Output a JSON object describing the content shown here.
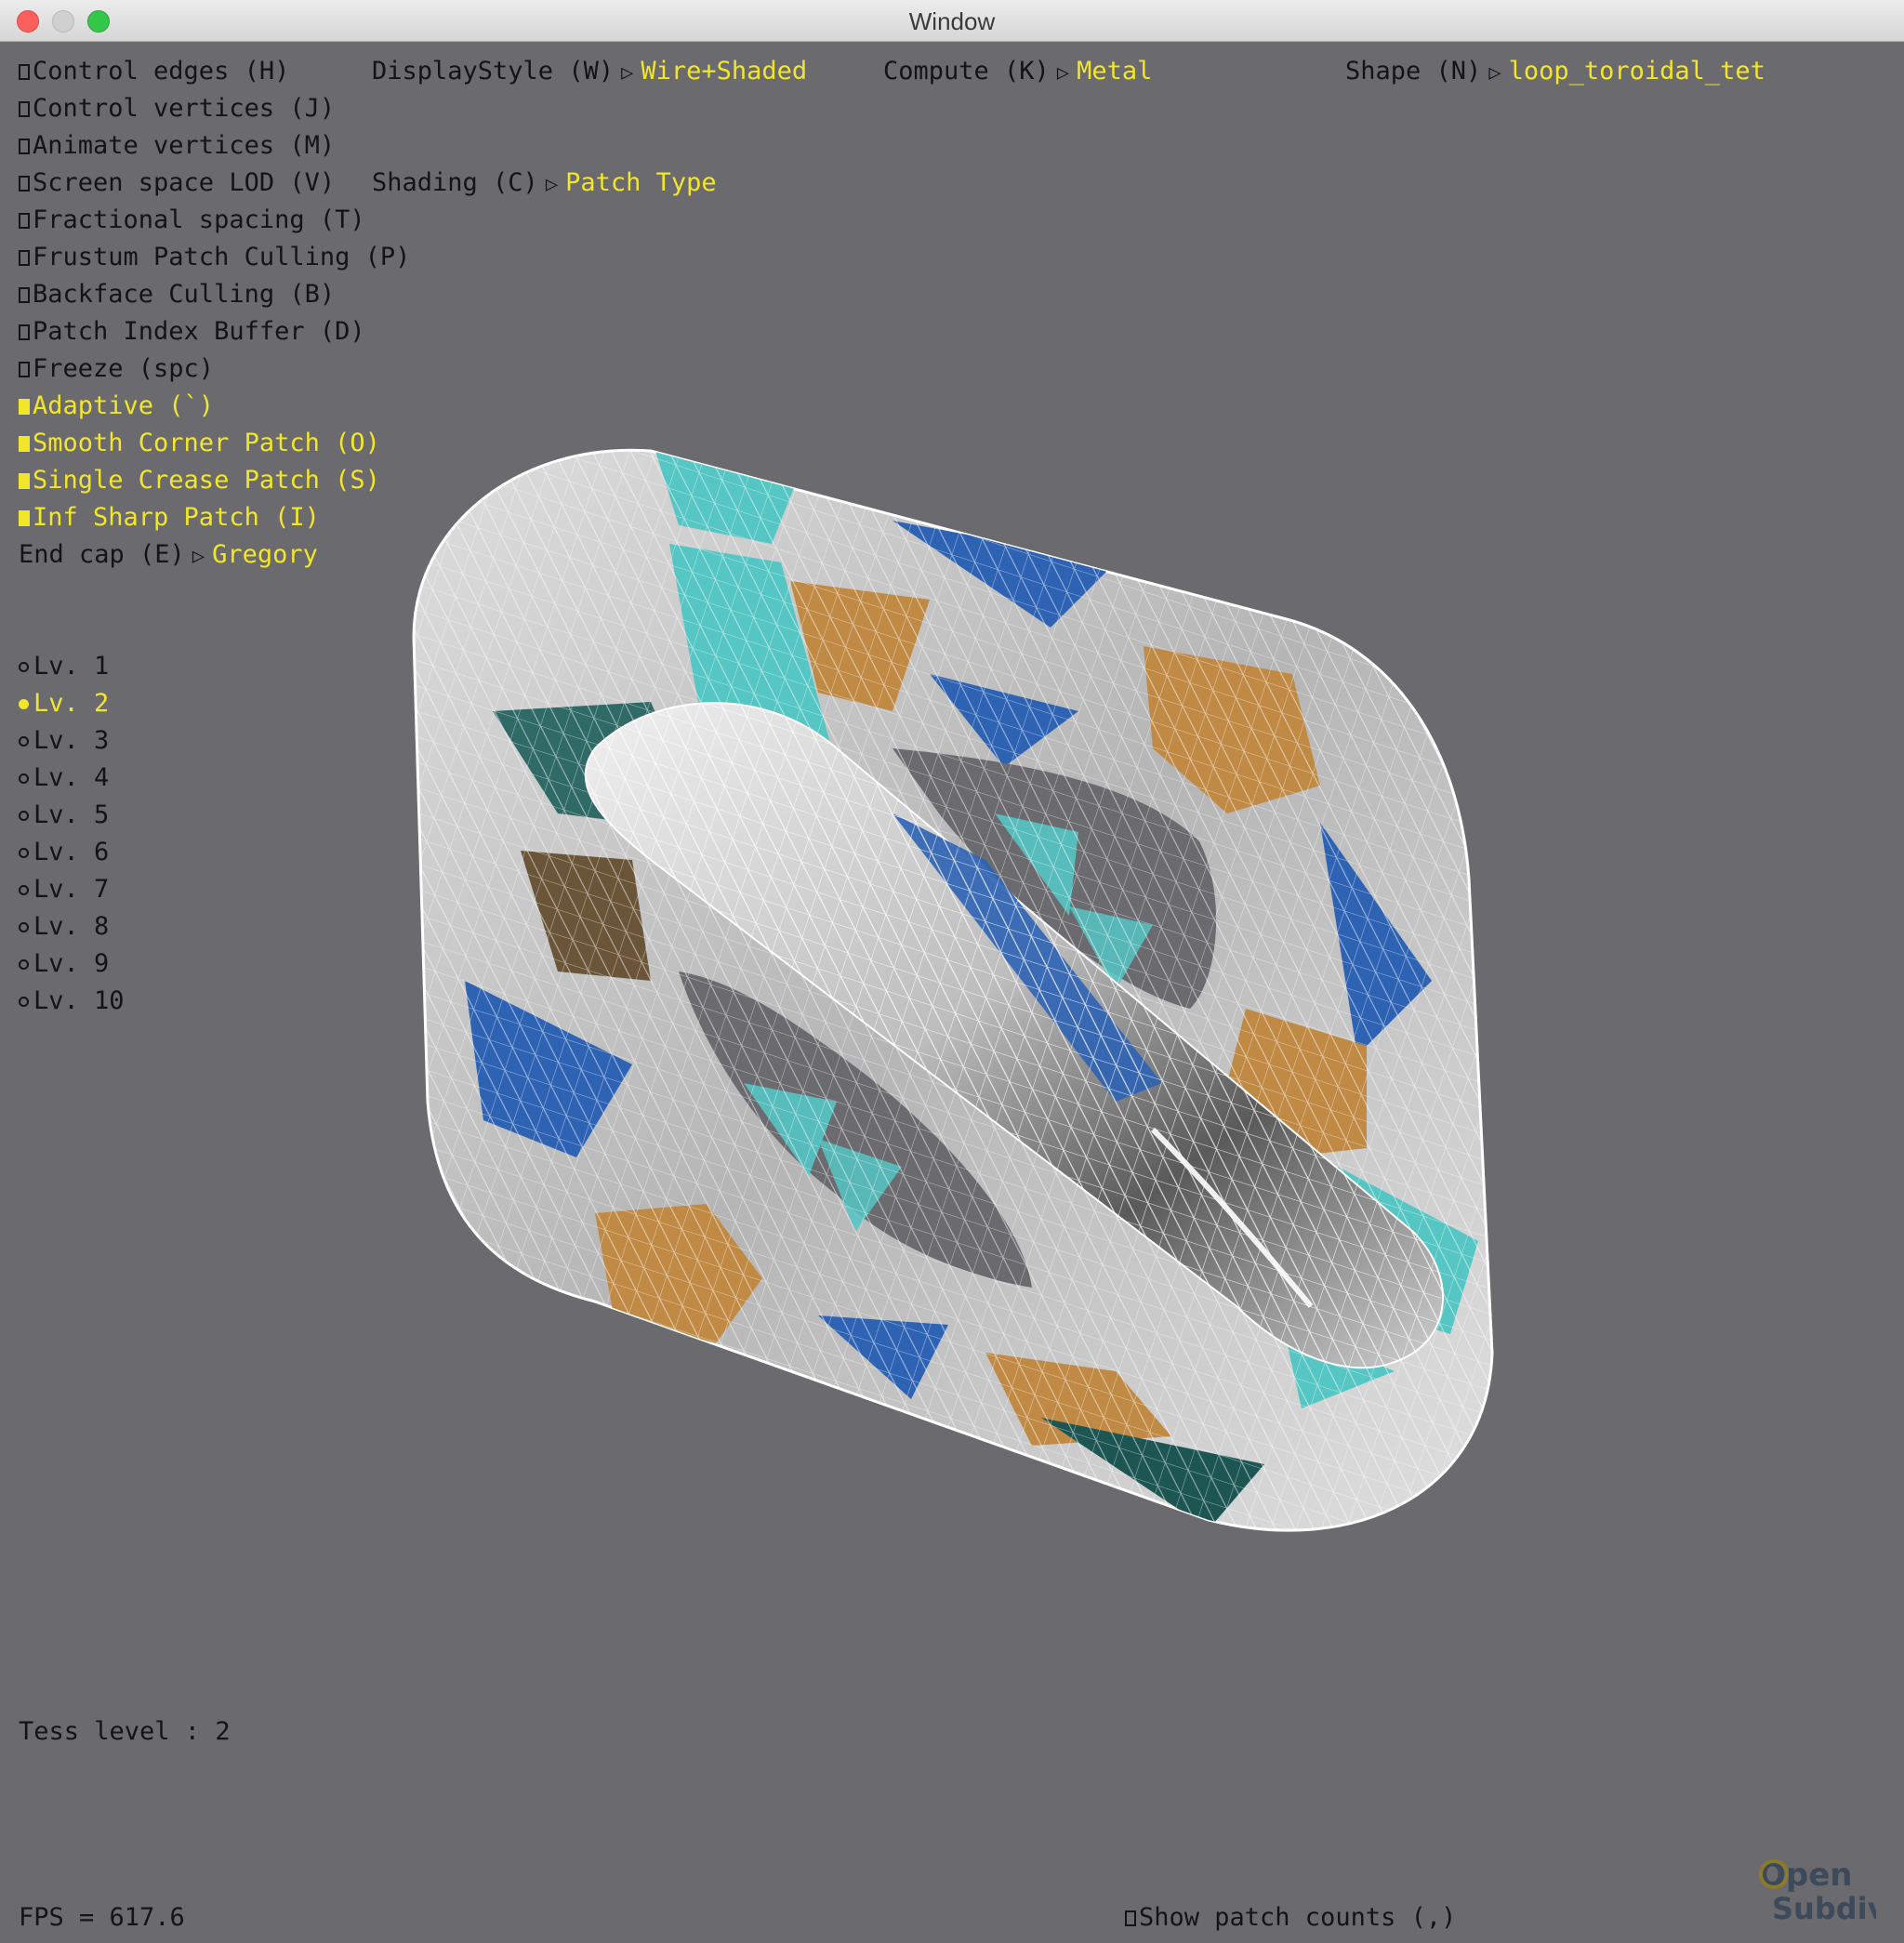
{
  "window": {
    "title": "Window"
  },
  "toggles": [
    {
      "label": "Control edges (H)",
      "checked": false
    },
    {
      "label": "Control vertices (J)",
      "checked": false
    },
    {
      "label": "Animate vertices (M)",
      "checked": false
    },
    {
      "label": "Screen space LOD (V)",
      "checked": false
    },
    {
      "label": "Fractional spacing (T)",
      "checked": false
    },
    {
      "label": "Frustum Patch Culling (P)",
      "checked": false
    },
    {
      "label": "Backface Culling (B)",
      "checked": false
    },
    {
      "label": "Patch Index Buffer (D)",
      "checked": false
    },
    {
      "label": "Freeze (spc)",
      "checked": false
    },
    {
      "label": "Adaptive (`)",
      "checked": true
    },
    {
      "label": "Smooth Corner Patch (O)",
      "checked": true
    },
    {
      "label": "Single Crease Patch (S)",
      "checked": true
    },
    {
      "label": "Inf Sharp Patch (I)",
      "checked": true
    }
  ],
  "endcap": {
    "label": "End cap (E)",
    "value": "Gregory"
  },
  "dropdowns": {
    "display_style": {
      "label": "DisplayStyle (W)",
      "value": "Wire+Shaded"
    },
    "compute": {
      "label": "Compute (K)",
      "value": "Metal"
    },
    "shape": {
      "label": "Shape (N)",
      "value": "loop_toroidal_tet"
    },
    "shading": {
      "label": "Shading (C)",
      "value": "Patch Type"
    }
  },
  "levels": {
    "items": [
      "Lv. 1",
      "Lv. 2",
      "Lv. 3",
      "Lv. 4",
      "Lv. 5",
      "Lv. 6",
      "Lv. 7",
      "Lv. 8",
      "Lv. 9",
      "Lv. 10"
    ],
    "selected": 1
  },
  "status": {
    "tess_level": "Tess level : 2",
    "fps": "FPS = 617.6",
    "show_patch_counts": "Show patch counts (,)"
  },
  "logo": {
    "line1": "Open",
    "line2": "Subdiv"
  },
  "colors": {
    "background": "#6b6a6e",
    "highlight": "#f2e62a",
    "patch_cyan": "#55c6c4",
    "patch_blue": "#2e63b4",
    "patch_orange": "#c08a45",
    "surface_grey": "#c8c8c8"
  }
}
